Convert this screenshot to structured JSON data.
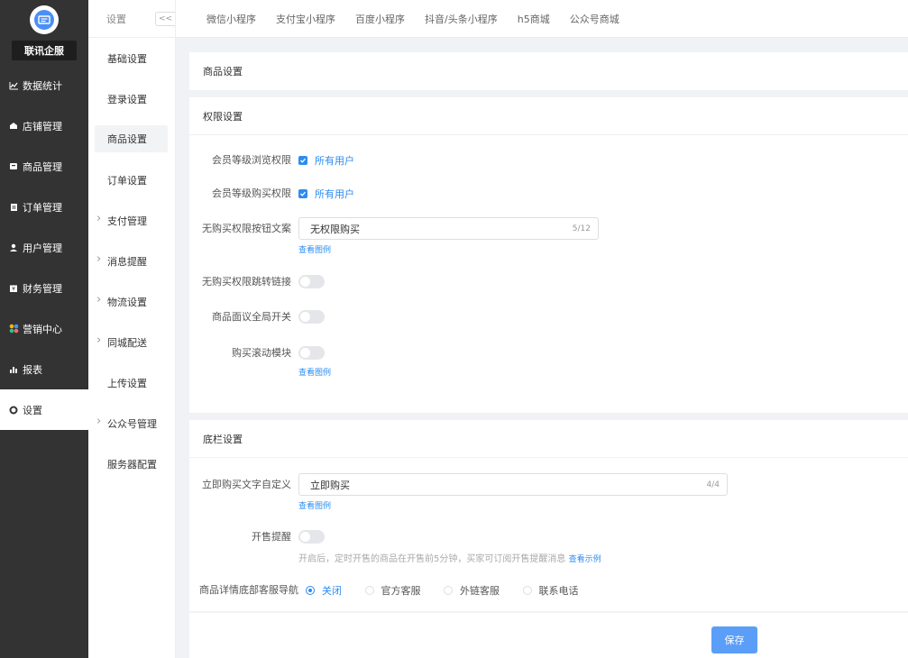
{
  "brand": {
    "name": "联讯企服"
  },
  "sidebar": {
    "items": [
      {
        "label": "数据统计",
        "icon": "line-chart-icon"
      },
      {
        "label": "店铺管理",
        "icon": "store-icon"
      },
      {
        "label": "商品管理",
        "icon": "goods-icon"
      },
      {
        "label": "订单管理",
        "icon": "order-icon"
      },
      {
        "label": "用户管理",
        "icon": "user-icon"
      },
      {
        "label": "财务管理",
        "icon": "finance-icon"
      },
      {
        "label": "营销中心",
        "icon": "marketing-icon"
      },
      {
        "label": "报表",
        "icon": "bar-chart-icon"
      },
      {
        "label": "设置",
        "icon": "gear-icon"
      }
    ]
  },
  "submenu": {
    "title": "设置",
    "collapse": "<<",
    "items": [
      {
        "label": "基础设置"
      },
      {
        "label": "登录设置"
      },
      {
        "label": "商品设置"
      },
      {
        "label": "订单设置"
      },
      {
        "label": "支付管理"
      },
      {
        "label": "消息提醒"
      },
      {
        "label": "物流设置"
      },
      {
        "label": "同城配送"
      },
      {
        "label": "上传设置"
      },
      {
        "label": "公众号管理"
      },
      {
        "label": "服务器配置"
      }
    ]
  },
  "tabs": [
    "微信小程序",
    "支付宝小程序",
    "百度小程序",
    "抖音/头条小程序",
    "h5商城",
    "公众号商城"
  ],
  "page": {
    "title": "商品设置",
    "permission": {
      "title": "权限设置",
      "browse_label": "会员等级浏览权限",
      "browse_value": "所有用户",
      "buy_label": "会员等级购买权限",
      "buy_value": "所有用户",
      "btn_text_label": "无购买权限按钮文案",
      "btn_text_value": "无权限购买",
      "btn_text_count": "5/12",
      "view_example": "查看图例",
      "jump_label": "无购买权限跳转链接",
      "negotiable_label": "商品面议全局开关",
      "scroll_label": "购买滚动模块",
      "scroll_example": "查看图例"
    },
    "bottom_bar": {
      "title": "底栏设置",
      "buy_text_label": "立即购买文字自定义",
      "buy_text_value": "立即购买",
      "buy_text_count": "4/4",
      "view_example": "查看图例",
      "presale_label": "开售提醒",
      "presale_hint": "开启后，定时开售的商品在开售前5分钟，买家可订阅开售提醒消息",
      "presale_example": "查看示例",
      "service_label": "商品详情底部客服导航",
      "service_options": [
        "关闭",
        "官方客服",
        "外链客服",
        "联系电话"
      ]
    },
    "save_label": "保存"
  }
}
